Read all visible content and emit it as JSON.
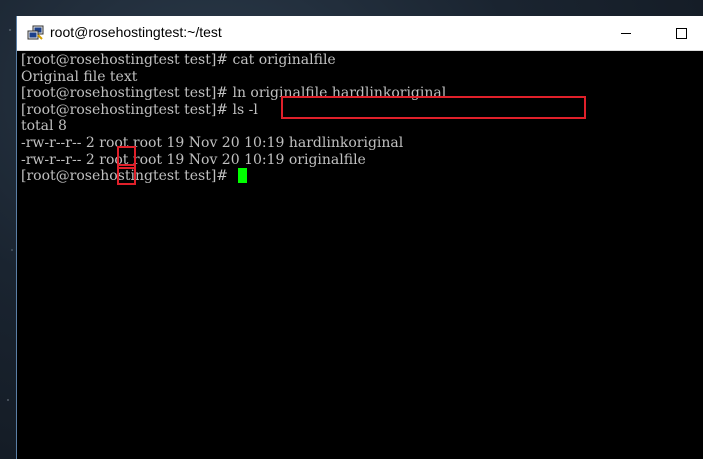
{
  "window": {
    "title": "root@rosehostingtest:~/test",
    "app_icon": "putty-terminal-icon"
  },
  "terminal": {
    "lines": [
      "[root@rosehostingtest test]# cat originalfile",
      "Original file text",
      "[root@rosehostingtest test]# ln originalfile hardlinkoriginal",
      "[root@rosehostingtest test]# ls -l",
      "total 8",
      "-rw-r--r-- 2 root root 19 Nov 20 10:19 hardlinkoriginal",
      "-rw-r--r-- 2 root root 19 Nov 20 10:19 originalfile",
      "[root@rosehostingtest test]# "
    ],
    "cursor_color": "#00ff00",
    "text_color": "#c0c0c0",
    "highlight_color": "#e0202a"
  }
}
